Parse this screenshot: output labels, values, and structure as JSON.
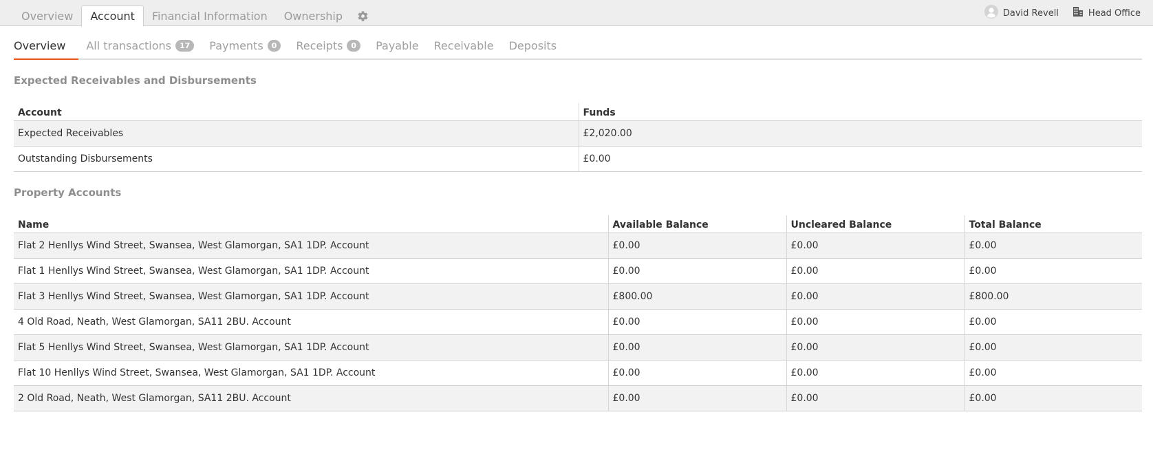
{
  "top_tabs": [
    {
      "label": "Overview",
      "active": false
    },
    {
      "label": "Account",
      "active": true
    },
    {
      "label": "Financial Information",
      "active": false
    },
    {
      "label": "Ownership",
      "active": false
    }
  ],
  "user": {
    "name": "David Revell",
    "icon": "user-avatar-icon"
  },
  "office": {
    "name": "Head Office",
    "icon": "building-icon"
  },
  "sub_tabs": [
    {
      "label": "Overview",
      "badge": null,
      "active": true
    },
    {
      "label": "All transactions",
      "badge": "17",
      "active": false
    },
    {
      "label": "Payments",
      "badge": "0",
      "active": false
    },
    {
      "label": "Receipts",
      "badge": "0",
      "active": false
    },
    {
      "label": "Payable",
      "badge": null,
      "active": false
    },
    {
      "label": "Receivable",
      "badge": null,
      "active": false
    },
    {
      "label": "Deposits",
      "badge": null,
      "active": false
    }
  ],
  "expected": {
    "title": "Expected Receivables and Disbursements",
    "headers": [
      "Account",
      "Funds"
    ],
    "rows": [
      [
        "Expected Receivables",
        "£2,020.00"
      ],
      [
        "Outstanding Disbursements",
        "£0.00"
      ]
    ]
  },
  "property_accounts": {
    "title": "Property Accounts",
    "headers": [
      "Name",
      "Available Balance",
      "Uncleared Balance",
      "Total Balance"
    ],
    "rows": [
      [
        "Flat 2 Henllys Wind Street, Swansea, West Glamorgan, SA1 1DP. Account",
        "£0.00",
        "£0.00",
        "£0.00"
      ],
      [
        "Flat 1 Henllys Wind Street, Swansea, West Glamorgan, SA1 1DP. Account",
        "£0.00",
        "£0.00",
        "£0.00"
      ],
      [
        "Flat 3 Henllys Wind Street, Swansea, West Glamorgan, SA1 1DP. Account",
        "£800.00",
        "£0.00",
        "£800.00"
      ],
      [
        "4 Old Road, Neath, West Glamorgan, SA11 2BU. Account",
        "£0.00",
        "£0.00",
        "£0.00"
      ],
      [
        "Flat 5 Henllys Wind Street, Swansea, West Glamorgan, SA1 1DP. Account",
        "£0.00",
        "£0.00",
        "£0.00"
      ],
      [
        "Flat 10 Henllys Wind Street, Swansea, West Glamorgan, SA1 1DP. Account",
        "£0.00",
        "£0.00",
        "£0.00"
      ],
      [
        "2 Old Road, Neath, West Glamorgan, SA11 2BU. Account",
        "£0.00",
        "£0.00",
        "£0.00"
      ]
    ]
  },
  "colors": {
    "accent": "#e8541c",
    "badge": "#b7b7b7",
    "topbar": "#eeeeee"
  }
}
